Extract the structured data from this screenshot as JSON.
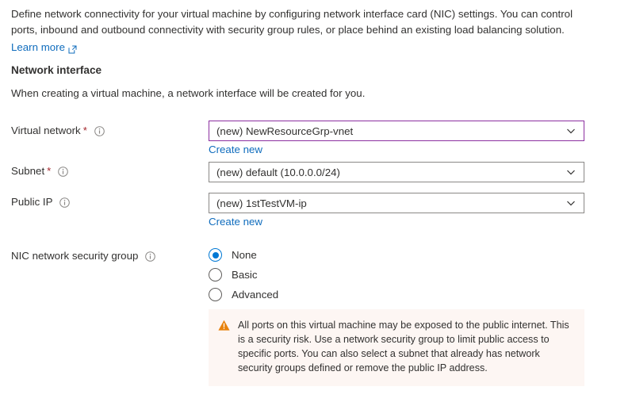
{
  "intro": {
    "paragraph": "Define network connectivity for your virtual machine by configuring network interface card (NIC) settings. You can control ports, inbound and outbound connectivity with security group rules, or place behind an existing load balancing solution.",
    "learn_more_label": "Learn more",
    "learn_more_icon": "external-link-icon"
  },
  "section": {
    "title": "Network interface",
    "subtitle": "When creating a virtual machine, a network interface will be created for you."
  },
  "fields": {
    "virtual_network": {
      "label": "Virtual network",
      "required_marker": "*",
      "info_icon": "info-icon",
      "value": "(new) NewResourceGrp-vnet",
      "chevron_icon": "chevron-down-icon",
      "create_new_label": "Create new",
      "focused": true
    },
    "subnet": {
      "label": "Subnet",
      "required_marker": "*",
      "info_icon": "info-icon",
      "value": "(new) default (10.0.0.0/24)",
      "chevron_icon": "chevron-down-icon",
      "focused": false
    },
    "public_ip": {
      "label": "Public IP",
      "info_icon": "info-icon",
      "value": "(new) 1stTestVM-ip",
      "chevron_icon": "chevron-down-icon",
      "create_new_label": "Create new",
      "focused": false
    },
    "nic_nsg": {
      "label": "NIC network security group",
      "info_icon": "info-icon",
      "options": [
        {
          "label": "None",
          "selected": true
        },
        {
          "label": "Basic",
          "selected": false
        },
        {
          "label": "Advanced",
          "selected": false
        }
      ]
    }
  },
  "warning": {
    "icon": "warning-triangle-icon",
    "text": "All ports on this virtual machine may be exposed to the public internet. This is a security risk. Use a network security group to limit public access to specific ports. You can also select a subnet that already has network security groups defined or remove the public IP address."
  },
  "colors": {
    "link": "#0f6cbd",
    "required": "#a4262c",
    "focus_border": "#8c2fa0",
    "radio_selected": "#0078d4",
    "warning_bg": "#fdf6f3",
    "warning_icon": "#e8820c",
    "border": "#8a8886",
    "text": "#323130"
  }
}
